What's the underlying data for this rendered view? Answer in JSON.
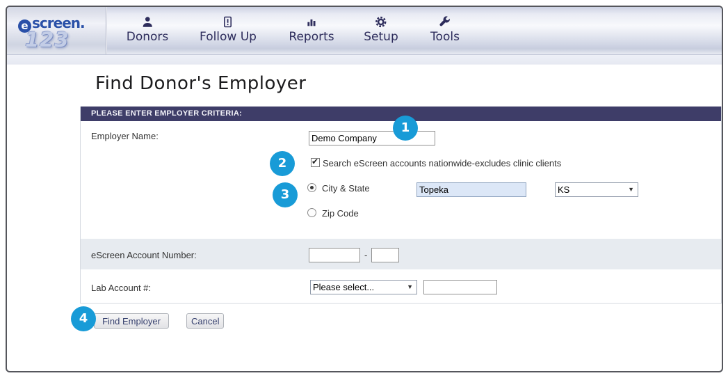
{
  "page": {
    "title": "Find Donor's Employer"
  },
  "nav": {
    "logo": {
      "mark": "e",
      "rest": "screen.",
      "sub": "123"
    },
    "items": [
      {
        "label": "Donors",
        "icon": "person-icon"
      },
      {
        "label": "Follow Up",
        "icon": "alert-document-icon"
      },
      {
        "label": "Reports",
        "icon": "bar-chart-icon"
      },
      {
        "label": "Setup",
        "icon": "gear-icon"
      },
      {
        "label": "Tools",
        "icon": "wrench-icon"
      }
    ]
  },
  "form": {
    "header": "PLEASE ENTER EMPLOYER CRITERIA:",
    "employer_name": {
      "label": "Employer Name:",
      "value": "Demo Company"
    },
    "nationwide": {
      "label": "Search eScreen accounts nationwide-excludes clinic clients",
      "checked": true
    },
    "location": {
      "city_state": {
        "label": "City & State",
        "selected": true
      },
      "city": {
        "value": "Topeka"
      },
      "state": {
        "value": "KS"
      },
      "zip": {
        "label": "Zip Code",
        "selected": false
      }
    },
    "account_number": {
      "label": "eScreen Account Number:",
      "value1": "",
      "separator": "-",
      "value2": ""
    },
    "lab_account": {
      "label": "Lab Account #:",
      "select_value": "Please select...",
      "value": ""
    },
    "actions": {
      "find": "Find Employer",
      "cancel": "Cancel"
    }
  },
  "annotations": {
    "steps": [
      "1",
      "2",
      "3",
      "4"
    ],
    "color": "#189bd7"
  },
  "colors": {
    "header_bar": "#3e3d68",
    "annotation_blue": "#189bd7",
    "nav_ink": "#2e2d5c",
    "logo_blue": "#2a50a8",
    "row_gray": "#e7ebf0"
  }
}
